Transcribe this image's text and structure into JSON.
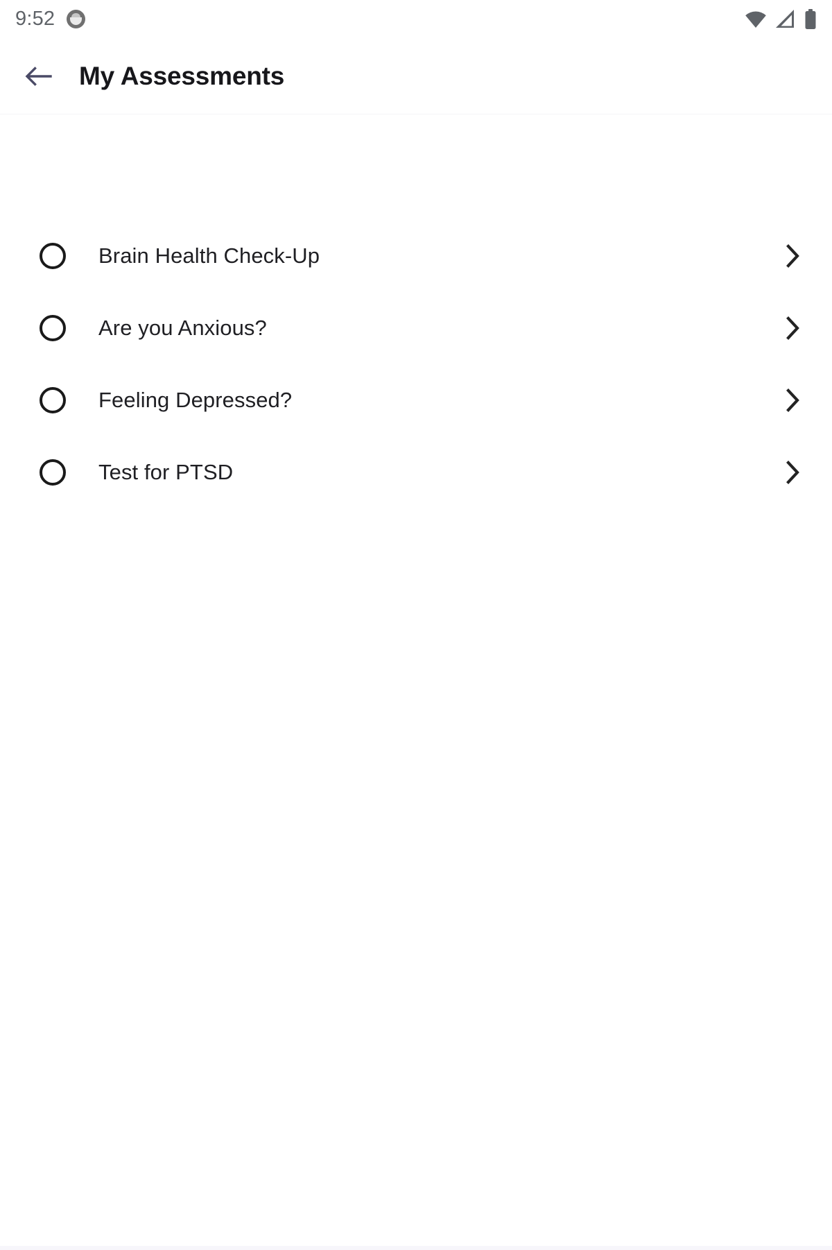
{
  "status_bar": {
    "time": "9:52",
    "app_icon": "app-notification-icon",
    "icons": [
      "wifi-icon",
      "cellular-signal-icon",
      "battery-icon"
    ]
  },
  "app_bar": {
    "back_icon": "back-arrow-icon",
    "title": "My Assessments"
  },
  "list": {
    "items": [
      {
        "label": "Brain Health Check-Up",
        "selected": false,
        "chevron": "chevron-right-icon"
      },
      {
        "label": "Are you Anxious?",
        "selected": false,
        "chevron": "chevron-right-icon"
      },
      {
        "label": "Feeling Depressed?",
        "selected": false,
        "chevron": "chevron-right-icon"
      },
      {
        "label": "Test for PTSD",
        "selected": false,
        "chevron": "chevron-right-icon"
      }
    ]
  },
  "colors": {
    "background": "#ffffff",
    "title_text": "#17171b",
    "item_text": "#1f1f23",
    "back_arrow": "#4a4a66",
    "status_icon": "#5f6368",
    "radio_border": "#1a1a1a",
    "chevron": "#232323",
    "divider": "#f4f4f7",
    "bottom_strip": "#f7f6fb"
  }
}
